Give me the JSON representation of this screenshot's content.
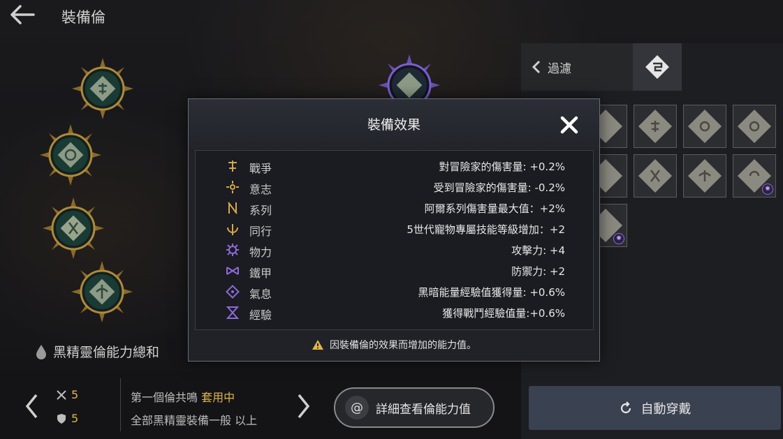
{
  "header": {
    "title": "裝備倫"
  },
  "ability_sum_label": "黑精靈倫能力總和",
  "bottom": {
    "stat1": "5",
    "stat2": "5",
    "line1_prefix": "第一個倫共鳴",
    "line1_status": "套用中",
    "line2": "全部黑精靈裝備一般 以上",
    "detail_button": "詳細查看倫能力值"
  },
  "right_panel": {
    "filter_label": "過濾",
    "auto_equip_button": "自動穿戴"
  },
  "modal": {
    "title": "裝備效果",
    "rows": [
      {
        "name": "戰爭",
        "value": "對冒險家的傷害量: +0.2%",
        "icon": "war-rune-icon"
      },
      {
        "name": "意志",
        "value": "受到冒險家的傷害量: -0.2%",
        "icon": "will-rune-icon"
      },
      {
        "name": "系列",
        "value": "阿爾系列傷害量最大值：+2%",
        "icon": "series-rune-icon"
      },
      {
        "name": "同行",
        "value": "5世代寵物專屬技能等級增加：+2",
        "icon": "companion-rune-icon"
      },
      {
        "name": "物力",
        "value": "攻擊力: +4",
        "icon": "physical-rune-icon"
      },
      {
        "name": "鐵甲",
        "value": "防禦力: +2",
        "icon": "armor-rune-icon"
      },
      {
        "name": "氣息",
        "value": "黑暗能量經驗值獲得量: +0.6%",
        "icon": "breath-rune-icon"
      },
      {
        "name": "經驗",
        "value": "獲得戰鬥經驗值量:+0.6%",
        "icon": "experience-rune-icon"
      }
    ],
    "note": "因裝備倫的效果而增加的能力值。"
  },
  "colors": {
    "gold": "#e0b64a",
    "purple": "#7b5fd0",
    "accent_button": "#3a4150"
  }
}
